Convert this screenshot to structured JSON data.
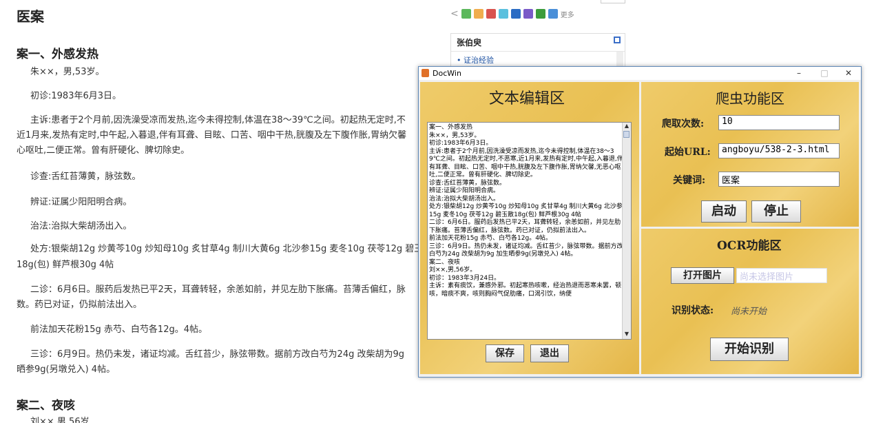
{
  "page": {
    "title": "医案",
    "case1_title": "案一、外感发热",
    "paragraphs": [
      "朱××，男,53岁。",
      "初诊:1983年6月3日。",
      "主诉:患者于2个月前,因洗澡受凉而发热,迄今未得控制,体温在38～39℃之间。初起热无定时,不",
      "近1月来,发热有定时,中午起,入暮退,伴有耳聋、目眩、口苦、咽中干热,胱腹及左下腹作胀,胃纳欠馨",
      "心呕吐,二便正常。曾有肝硬化、脾切除史。",
      "诊查:舌红苔薄黄，脉弦数。",
      "辨证:证属少阳阳明合病。",
      "治法:治拟大柴胡汤出入。",
      "处方:银柴胡12g 炒黄芩10g 炒知母10g 炙甘草4g 制川大黄6g 北沙参15g 麦冬10g 茯苓12g 碧玉",
      "18g(包) 鲜芦根30g 4帖",
      "二诊：6月6日。服药后发热已平2天，耳聋转轻，余恙如前，并见左肋下胀痛。苔薄舌偏红，脉",
      "数。药已对证，仍拟前法出入。",
      "前法加天花粉15g 赤芍、白芍各12g。4帖。",
      "三诊：6月9日。热仍未发，诸证均减。舌红苔少，脉弦带数。据前方改白芍为24g 改柴胡为9g",
      "晒参9g(另墩兑入) 4帖。"
    ],
    "case2_title": "案二、夜咳",
    "case2_first_line": "刘××,男,56岁"
  },
  "sidebar": {
    "share_more": "更多",
    "box_title": "张伯臾",
    "box_link": "证治经验"
  },
  "window": {
    "title": "DocWin",
    "minimize": "–",
    "maximize": "□",
    "close": "✕",
    "editor_title": "文本编辑区",
    "editor_text": "案一、外感发热\n朱××，男,53岁。\n初诊:1983年6月3日。\n主诉:患者于2个月前,因洗澡受凉而发热,迄今未得控制,体温在38～39℃之间。初起热无定时,不恶寒,近1月来,发热有定时,中午起,入暮退,伴有耳聋、目眩、口苦、咽中干热,胱腹及左下腹作胀,胃纳欠馨,无恶心呕吐,二便正常。曾有肝硬化、脾切除史。\n诊查:舌红苔薄黄，脉弦数。\n辨证:证属少阳阳明合病。\n治法:治拟大柴胡汤出入。\n处方:银柴胡12g 炒黄芩10g 炒知母10g 炙甘草4g 制川大黄6g 北沙参15g 麦冬10g 茯苓12g 碧玉散18g(包) 鲜芦根30g 4帖\n二诊：6月6日。服药后发热已平2天，耳聋转轻，余恙如前，并见左肋下胀痛。苔薄舌偏红，脉弦数。药已对证，仍拟前法出入。\n前法加天花粉15g 赤芍、白芍各12g。4帖。\n三诊：6月9日。热仍未发，诸证均减。舌红苔少，脉弦带数。据前方改白芍为24g 改柴胡为9g 加生晒参9g(另墩兑入) 4帖。\n案二、夜咳\n刘××,男,56岁。\n初诊：1983年3月24日。\n主诉：素有痰饮，兼感外邪。初起寒热咳嗽，经治热退而恶寒未罢，顿咳，暗痰不爽，咳则胸闷气促肋痛，口渴引饮，纳便",
    "save_button": "保存",
    "exit_button": "退出",
    "crawler_title": "爬虫功能区",
    "crawl_count_label": "爬取次数:",
    "crawl_count_value": "10",
    "start_url_label": "起始URL:",
    "start_url_value": "angboyu/538-2-3.html",
    "keyword_label": "关键词:",
    "keyword_value": "医案",
    "start_button": "启动",
    "stop_button": "停止",
    "ocr_title": "OCR功能区",
    "open_image_button": "打开图片",
    "image_placeholder": "尚未选择图片",
    "recognize_status_label": "识别状态:",
    "recognize_status_value": "尚未开始",
    "start_recognize_button": "开始识别"
  }
}
